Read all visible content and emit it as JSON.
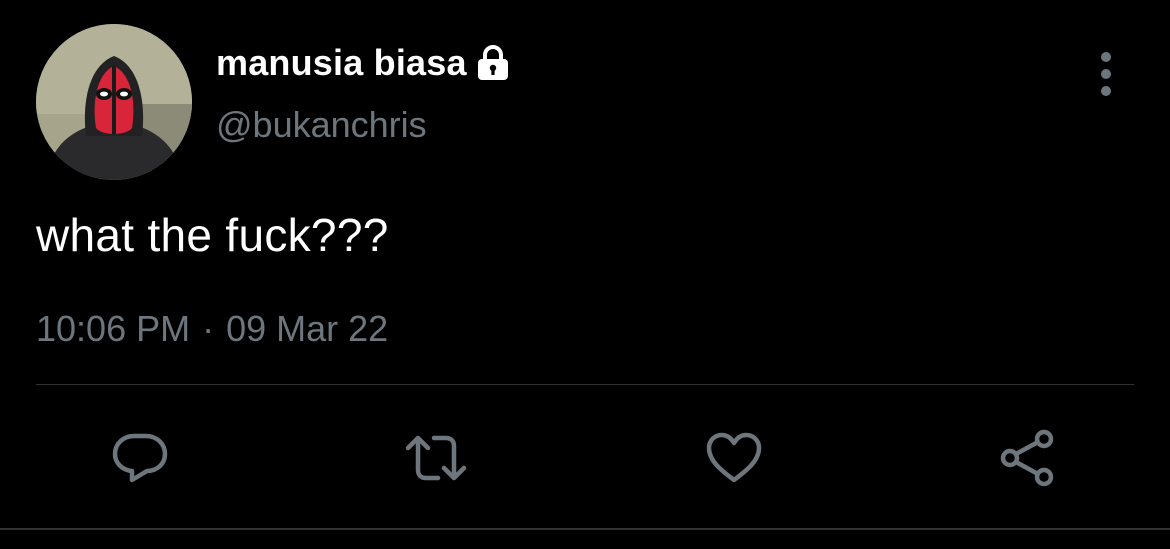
{
  "tweet": {
    "display_name": "manusia biasa",
    "handle": "@bukanchris",
    "protected": true,
    "text": "what the fuck???",
    "time": "10:06 PM",
    "separator": "·",
    "date": "09 Mar 22"
  },
  "icons": {
    "lock": "lock-icon",
    "more": "more-vertical-icon",
    "reply": "reply-icon",
    "retweet": "retweet-icon",
    "like": "heart-icon",
    "share": "share-icon"
  },
  "colors": {
    "background": "#000000",
    "primary_text": "#ffffff",
    "secondary_text": "#6e767d",
    "divider": "#2f3336"
  }
}
